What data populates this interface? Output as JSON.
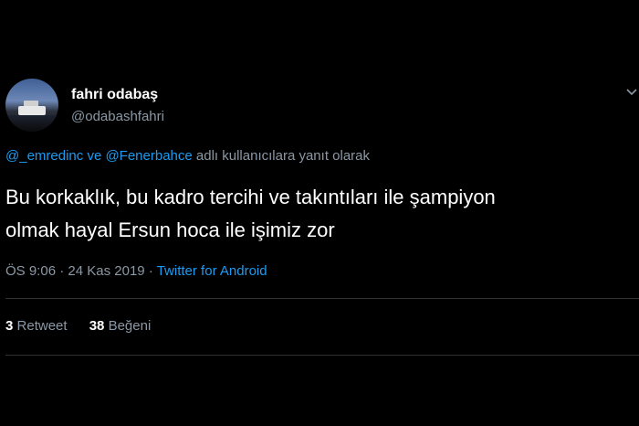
{
  "tweet": {
    "display_name": "fahri odabaş",
    "username": "@odabashfahri",
    "reply": {
      "mention1": "@_emredinc",
      "connector": "ve",
      "mention2": "@Fenerbahce",
      "suffix": "adlı kullanıcılara yanıt olarak"
    },
    "text_line1": "Bu korkaklık, bu kadro tercihi ve takıntıları ile şampiyon",
    "text_line2": "olmak hayal Ersun hoca ile işimiz zor",
    "time": "ÖS 9:06",
    "date": "24 Kas 2019",
    "separator": "·",
    "source": "Twitter for Android",
    "retweet_count": "3",
    "retweet_label": "Retweet",
    "like_count": "38",
    "like_label": "Beğeni"
  },
  "icons": {
    "caret": "chevron-down-icon",
    "avatar": "avatar-ship-image"
  },
  "colors": {
    "background": "#000000",
    "text": "#ffffff",
    "secondary": "#8b98a5",
    "link": "#1d9bf0",
    "divider": "#2f3336"
  }
}
